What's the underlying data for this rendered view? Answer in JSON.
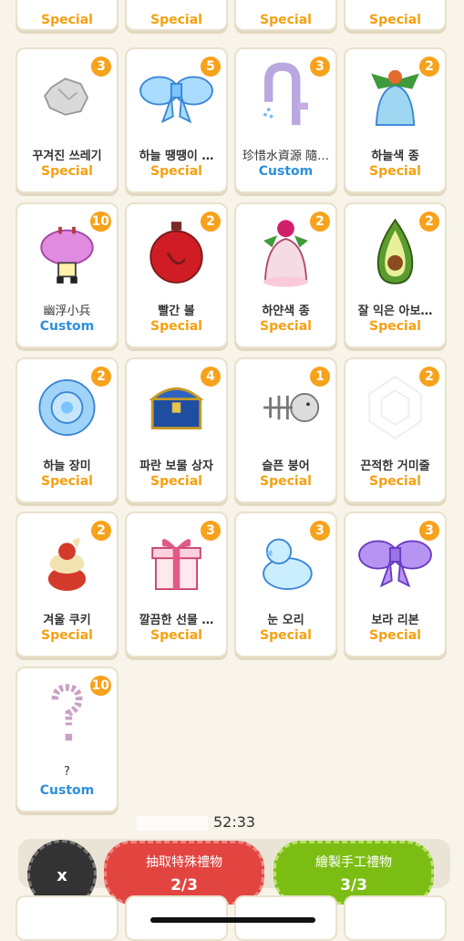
{
  "top_row_labels": [
    "Special",
    "Special",
    "Special",
    "Special"
  ],
  "items": [
    {
      "name": "꾸겨진 쓰레기",
      "kind": "Special",
      "count": "3",
      "icon": "crumpled-paper-icon"
    },
    {
      "name": "하늘 땡땡이 …",
      "kind": "Special",
      "count": "5",
      "icon": "blue-bow-icon"
    },
    {
      "name": "珍惜水資源 隨…",
      "kind": "Custom",
      "count": "3",
      "icon": "water-tap-icon"
    },
    {
      "name": "하늘색 종",
      "kind": "Special",
      "count": "2",
      "icon": "blue-bell-icon"
    },
    {
      "name": "幽浮小兵",
      "kind": "Custom",
      "count": "10",
      "icon": "ufo-soldier-icon"
    },
    {
      "name": "빨간 볼",
      "kind": "Special",
      "count": "2",
      "icon": "red-ornament-icon"
    },
    {
      "name": "하얀색 종",
      "kind": "Special",
      "count": "2",
      "icon": "white-bell-icon"
    },
    {
      "name": "잘 익은 아보…",
      "kind": "Special",
      "count": "2",
      "icon": "avocado-icon"
    },
    {
      "name": "하늘 장미",
      "kind": "Special",
      "count": "2",
      "icon": "blue-rose-icon"
    },
    {
      "name": "파란 보물 상자",
      "kind": "Special",
      "count": "4",
      "icon": "treasure-chest-icon"
    },
    {
      "name": "슬픈 붕어",
      "kind": "Special",
      "count": "1",
      "icon": "fish-bone-icon"
    },
    {
      "name": "끈적한 거미줄",
      "kind": "Special",
      "count": "2",
      "icon": "spider-web-icon"
    },
    {
      "name": "겨울 쿠키",
      "kind": "Special",
      "count": "2",
      "icon": "winter-cookie-icon"
    },
    {
      "name": "깔끔한 선물 …",
      "kind": "Special",
      "count": "3",
      "icon": "gift-box-icon"
    },
    {
      "name": "눈 오리",
      "kind": "Special",
      "count": "3",
      "icon": "snow-duck-icon"
    },
    {
      "name": "보라 리본",
      "kind": "Special",
      "count": "3",
      "icon": "purple-bow-icon"
    },
    {
      "name": "?",
      "kind": "Custom",
      "count": "10",
      "icon": "question-mark-icon"
    }
  ],
  "timer": {
    "time": "52:33",
    "prefix": "1"
  },
  "buttons": {
    "close": "x",
    "draw_special": {
      "label": "抽取特殊禮物",
      "progress": "2/3"
    },
    "draw_custom": {
      "label": "繪製手工禮物",
      "progress": "3/3"
    }
  },
  "colors": {
    "special": "#f5a011",
    "custom": "#2e8fdb",
    "badge": "#f7a21b",
    "red": "#e24540",
    "green": "#7cbd14"
  }
}
